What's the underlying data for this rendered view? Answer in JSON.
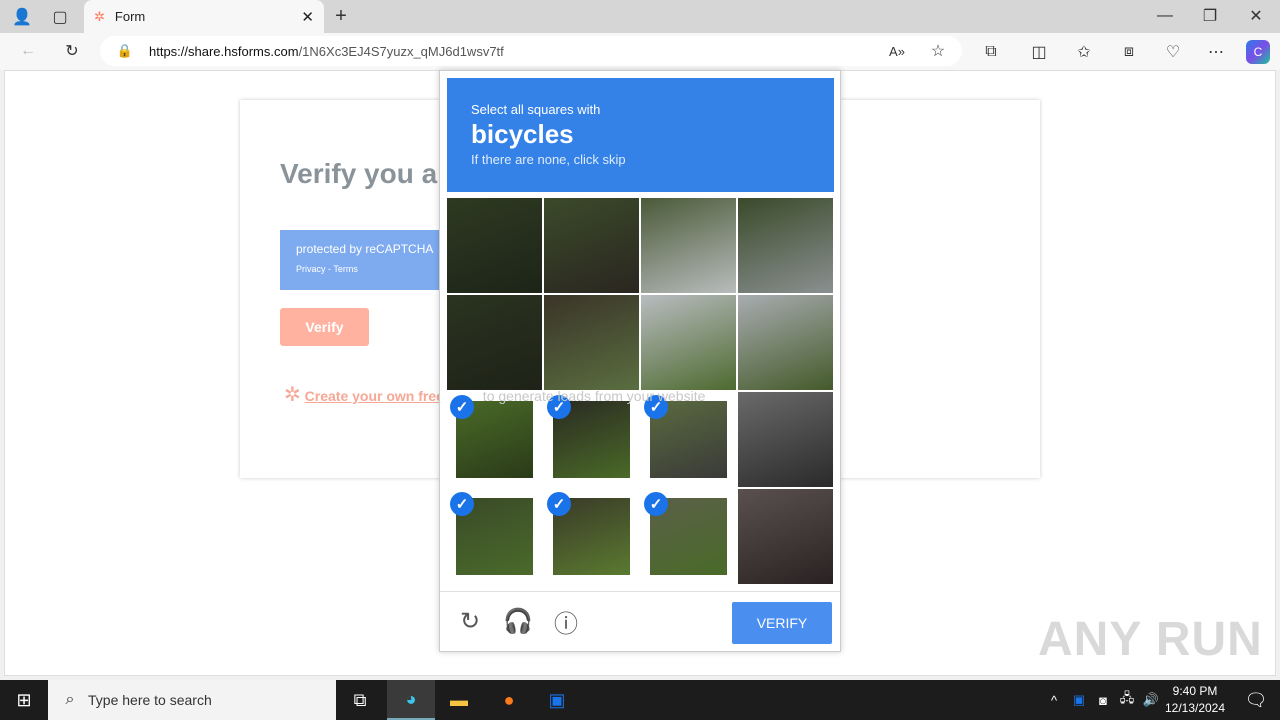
{
  "browser": {
    "tab_title": "Form",
    "url_host": "https://share.hsforms.com",
    "url_path": "/1N6Xc3EJ4S7yuzx_qMJ6d1wsv7tf"
  },
  "form": {
    "title": "Verify you are human!",
    "recaptcha_text": "protected by reCAPTCHA",
    "recaptcha_links": "Privacy - Terms",
    "verify_label": "Verify",
    "cta_link": "Create your own free form",
    "cta_rest": " to generate leads from your website"
  },
  "captcha": {
    "instruction": "Select all squares with",
    "target": "bicycles",
    "hint": "If there are none, click skip",
    "verify_label": "VERIFY",
    "accent": "#3482e8",
    "tiles": [
      {
        "selected": false,
        "colors": [
          "#2e3a22",
          "#1d2418"
        ]
      },
      {
        "selected": false,
        "colors": [
          "#3b4a2a",
          "#2a2620"
        ]
      },
      {
        "selected": false,
        "colors": [
          "#4a5a38",
          "#b8bcbc"
        ]
      },
      {
        "selected": false,
        "colors": [
          "#3a4a2a",
          "#8a9090"
        ]
      },
      {
        "selected": false,
        "colors": [
          "#2b3320",
          "#1e2218"
        ]
      },
      {
        "selected": false,
        "colors": [
          "#3a3428",
          "#5a6e40"
        ]
      },
      {
        "selected": false,
        "colors": [
          "#b8bcc0",
          "#4e6a30"
        ]
      },
      {
        "selected": false,
        "colors": [
          "#a8acb0",
          "#445a2a"
        ]
      },
      {
        "selected": true,
        "colors": [
          "#4a6a28",
          "#2a3a18"
        ]
      },
      {
        "selected": true,
        "colors": [
          "#2a2a22",
          "#4a6a28"
        ]
      },
      {
        "selected": true,
        "colors": [
          "#5a6a40",
          "#3a3a38"
        ]
      },
      {
        "selected": false,
        "colors": [
          "#6a6a6a",
          "#2a2a2a"
        ]
      },
      {
        "selected": true,
        "colors": [
          "#3a4a28",
          "#4a6a2a"
        ]
      },
      {
        "selected": true,
        "colors": [
          "#3a3a28",
          "#5a7a30"
        ]
      },
      {
        "selected": true,
        "colors": [
          "#5a6048",
          "#4a6a28"
        ]
      },
      {
        "selected": false,
        "colors": [
          "#5a5050",
          "#2a2222"
        ]
      }
    ]
  },
  "watermark": "ANY RUN",
  "taskbar": {
    "search_placeholder": "Type here to search",
    "time": "9:40 PM",
    "date": "12/13/2024"
  }
}
